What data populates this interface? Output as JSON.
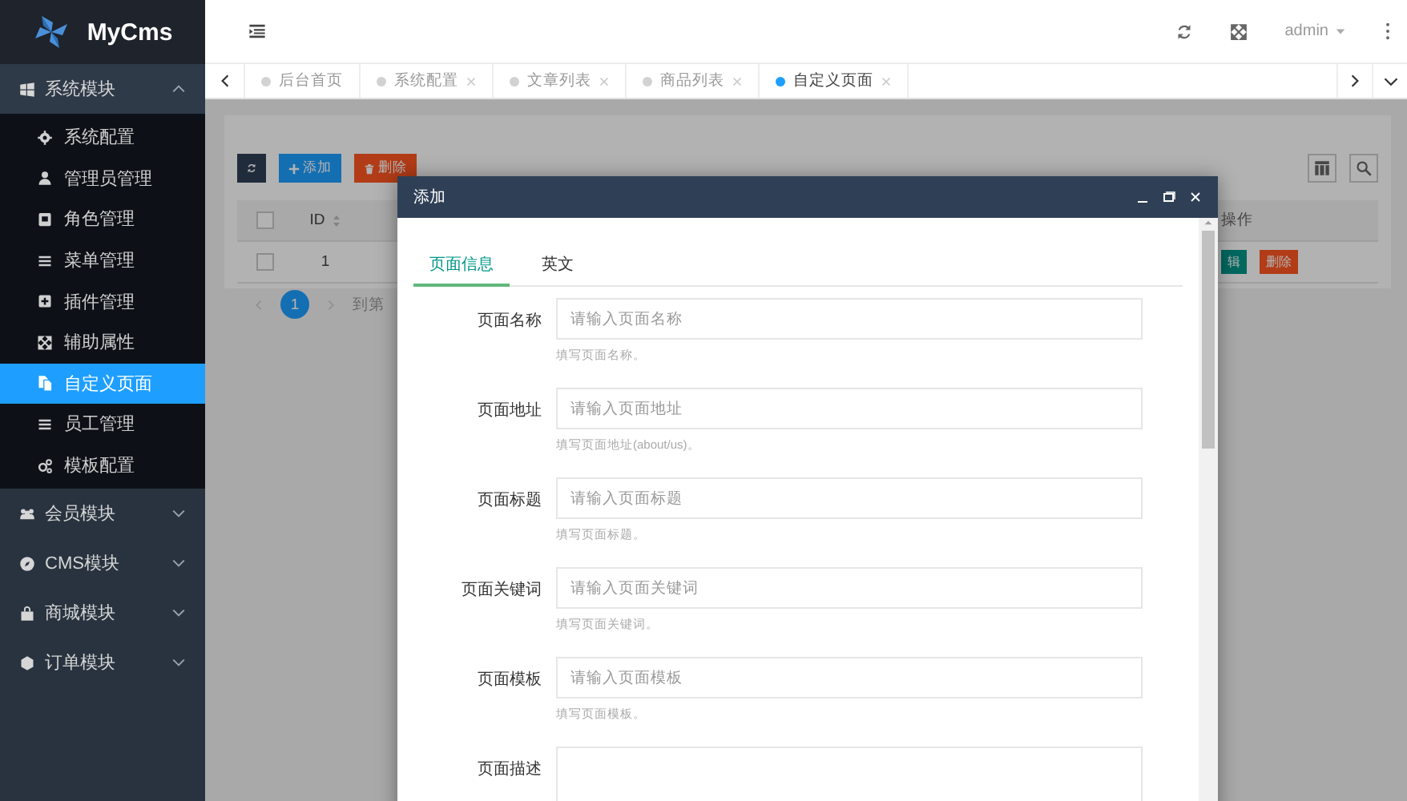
{
  "brand": {
    "name": "MyCms"
  },
  "sidebar": {
    "groups": [
      {
        "label": "系统模块",
        "expanded": true,
        "items": [
          {
            "label": "系统配置",
            "selected": false
          },
          {
            "label": "管理员管理",
            "selected": false
          },
          {
            "label": "角色管理",
            "selected": false
          },
          {
            "label": "菜单管理",
            "selected": false
          },
          {
            "label": "插件管理",
            "selected": false
          },
          {
            "label": "辅助属性",
            "selected": false
          },
          {
            "label": "自定义页面",
            "selected": true
          },
          {
            "label": "员工管理",
            "selected": false
          },
          {
            "label": "模板配置",
            "selected": false
          }
        ]
      },
      {
        "label": "会员模块",
        "expanded": false
      },
      {
        "label": "CMS模块",
        "expanded": false
      },
      {
        "label": "商城模块",
        "expanded": false
      },
      {
        "label": "订单模块",
        "expanded": false
      }
    ]
  },
  "header": {
    "user": "admin"
  },
  "tabs": [
    {
      "label": "后台首页",
      "closable": false,
      "selected": false
    },
    {
      "label": "系统配置",
      "closable": true,
      "selected": false
    },
    {
      "label": "文章列表",
      "closable": true,
      "selected": false
    },
    {
      "label": "商品列表",
      "closable": true,
      "selected": false
    },
    {
      "label": "自定义页面",
      "closable": true,
      "selected": true
    }
  ],
  "list": {
    "toolbar": [
      {
        "label": "添加",
        "kind": "add"
      },
      {
        "label": "删除",
        "kind": "delete"
      }
    ],
    "table": {
      "all_checked": false,
      "columns": [
        "ID",
        "操作"
      ],
      "rows": [
        {
          "checked": false,
          "id": "1",
          "actions": [
            {
              "label": "辑",
              "kind": "edit"
            },
            {
              "label": "删除",
              "kind": "delete"
            }
          ]
        }
      ]
    },
    "pagination": {
      "pages": [
        {
          "label": "1",
          "selected": true
        }
      ],
      "goto_label": "到第"
    }
  },
  "dialog": {
    "title": "添加",
    "tabs": [
      {
        "label": "页面信息",
        "selected": true
      },
      {
        "label": "英文",
        "selected": false
      }
    ],
    "fields": [
      {
        "kind": "input",
        "label": "页面名称",
        "placeholder": "请输入页面名称",
        "hint": "填写页面名称。"
      },
      {
        "kind": "input",
        "label": "页面地址",
        "placeholder": "请输入页面地址",
        "hint": "填写页面地址(about/us)。"
      },
      {
        "kind": "input",
        "label": "页面标题",
        "placeholder": "请输入页面标题",
        "hint": "填写页面标题。"
      },
      {
        "kind": "input",
        "label": "页面关键词",
        "placeholder": "请输入页面关键词",
        "hint": "填写页面关键词。"
      },
      {
        "kind": "input",
        "label": "页面模板",
        "placeholder": "请输入页面模板",
        "hint": "填写页面模板。"
      },
      {
        "kind": "textarea",
        "label": "页面描述"
      }
    ]
  }
}
